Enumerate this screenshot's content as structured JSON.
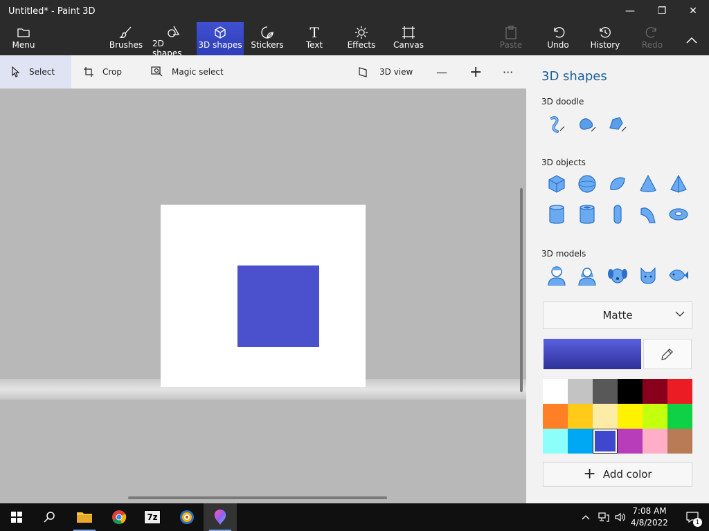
{
  "window": {
    "title": "Untitled* - Paint 3D",
    "minimize_glyph": "—",
    "restore_glyph": "❐",
    "close_glyph": "✕"
  },
  "ribbon": {
    "menu": "Menu",
    "brushes": "Brushes",
    "shapes2d": "2D shapes",
    "shapes3d": "3D shapes",
    "stickers": "Stickers",
    "text": "Text",
    "text_glyph": "T",
    "effects": "Effects",
    "canvas": "Canvas",
    "paste": "Paste",
    "undo": "Undo",
    "history": "History",
    "redo": "Redo"
  },
  "toolbar": {
    "select": "Select",
    "crop": "Crop",
    "magic_select": "Magic select",
    "view3d": "3D view",
    "zoom_out": "—",
    "zoom_in": "+",
    "more": "···"
  },
  "panel": {
    "title": "3D shapes",
    "doodle_label": "3D doodle",
    "objects_label": "3D objects",
    "models_label": "3D models",
    "material": "Matte",
    "add_color": "Add color",
    "add_glyph": "+",
    "current_color": "#4b50cc",
    "palette": [
      "#ffffff",
      "#c3c3c3",
      "#585858",
      "#000000",
      "#88001b",
      "#ec1c24",
      "#ff7f27",
      "#ffca18",
      "#fdeca6",
      "#fff200",
      "#c4ff0e",
      "#0ed145",
      "#8cfffb",
      "#00a8f3",
      "#3f48cc",
      "#b83dba",
      "#ffaec8",
      "#b97a56"
    ],
    "selected_swatch": 14
  },
  "canvas": {
    "shape_color": "#4b50cc"
  },
  "taskbar": {
    "apps": [
      "windows-start",
      "search",
      "file-explorer",
      "chrome",
      "7zip",
      "brave",
      "paint-3d"
    ],
    "zip_label": "7z",
    "time": "7:08 AM",
    "date": "4/8/2022",
    "notification_count": "1"
  }
}
